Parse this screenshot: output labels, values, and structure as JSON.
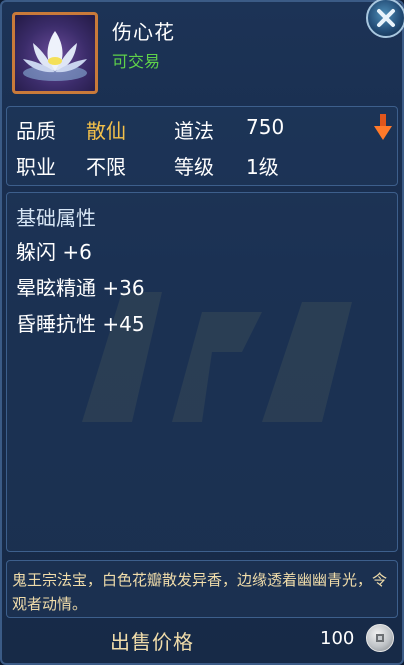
{
  "item": {
    "name": "伤心花",
    "tradable": "可交易"
  },
  "stats": {
    "quality_label": "品质",
    "quality_value": "散仙",
    "daofa_label": "道法",
    "daofa_value": "750",
    "class_label": "职业",
    "class_value": "不限",
    "level_label": "等级",
    "level_value": "1级"
  },
  "attributes": {
    "title": "基础属性",
    "items": [
      "躲闪 +6",
      "晕眩精通 +36",
      "昏睡抗性 +45"
    ]
  },
  "description": "鬼王宗法宝，白色花瓣散发异香，边缘透着幽幽青光，令观者动情。",
  "price": {
    "label": "出售价格",
    "value": "100"
  },
  "colors": {
    "quality": "#f3c04a",
    "tradable": "#5fd24a",
    "description": "#f0dcaa",
    "icon_frame": "#c97a3a"
  },
  "icons": {
    "close": "close-icon",
    "item": "lotus-flower-icon",
    "arrow": "down-arrow-icon",
    "currency": "coin-icon"
  }
}
